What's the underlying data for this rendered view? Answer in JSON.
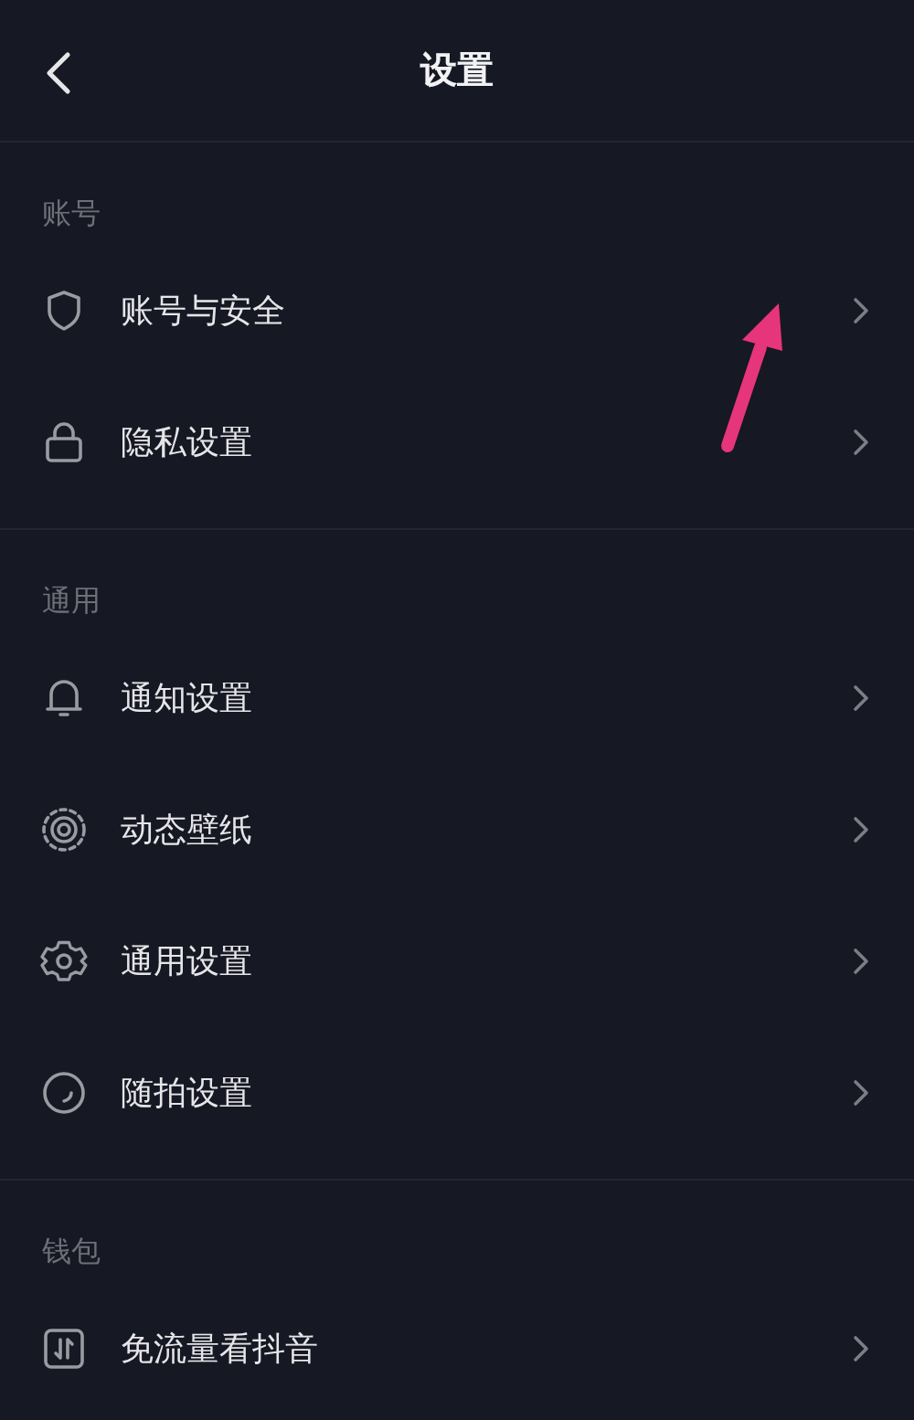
{
  "header": {
    "title": "设置"
  },
  "sections": [
    {
      "title": "账号",
      "items": [
        {
          "kind": "shield",
          "label": "账号与安全"
        },
        {
          "kind": "lock",
          "label": "隐私设置"
        }
      ]
    },
    {
      "title": "通用",
      "items": [
        {
          "kind": "bell",
          "label": "通知设置"
        },
        {
          "kind": "wallpaper",
          "label": "动态壁纸"
        },
        {
          "kind": "gear",
          "label": "通用设置"
        },
        {
          "kind": "circle",
          "label": "随拍设置"
        }
      ]
    },
    {
      "title": "钱包",
      "items": [
        {
          "kind": "data",
          "label": "免流量看抖音"
        }
      ]
    }
  ]
}
